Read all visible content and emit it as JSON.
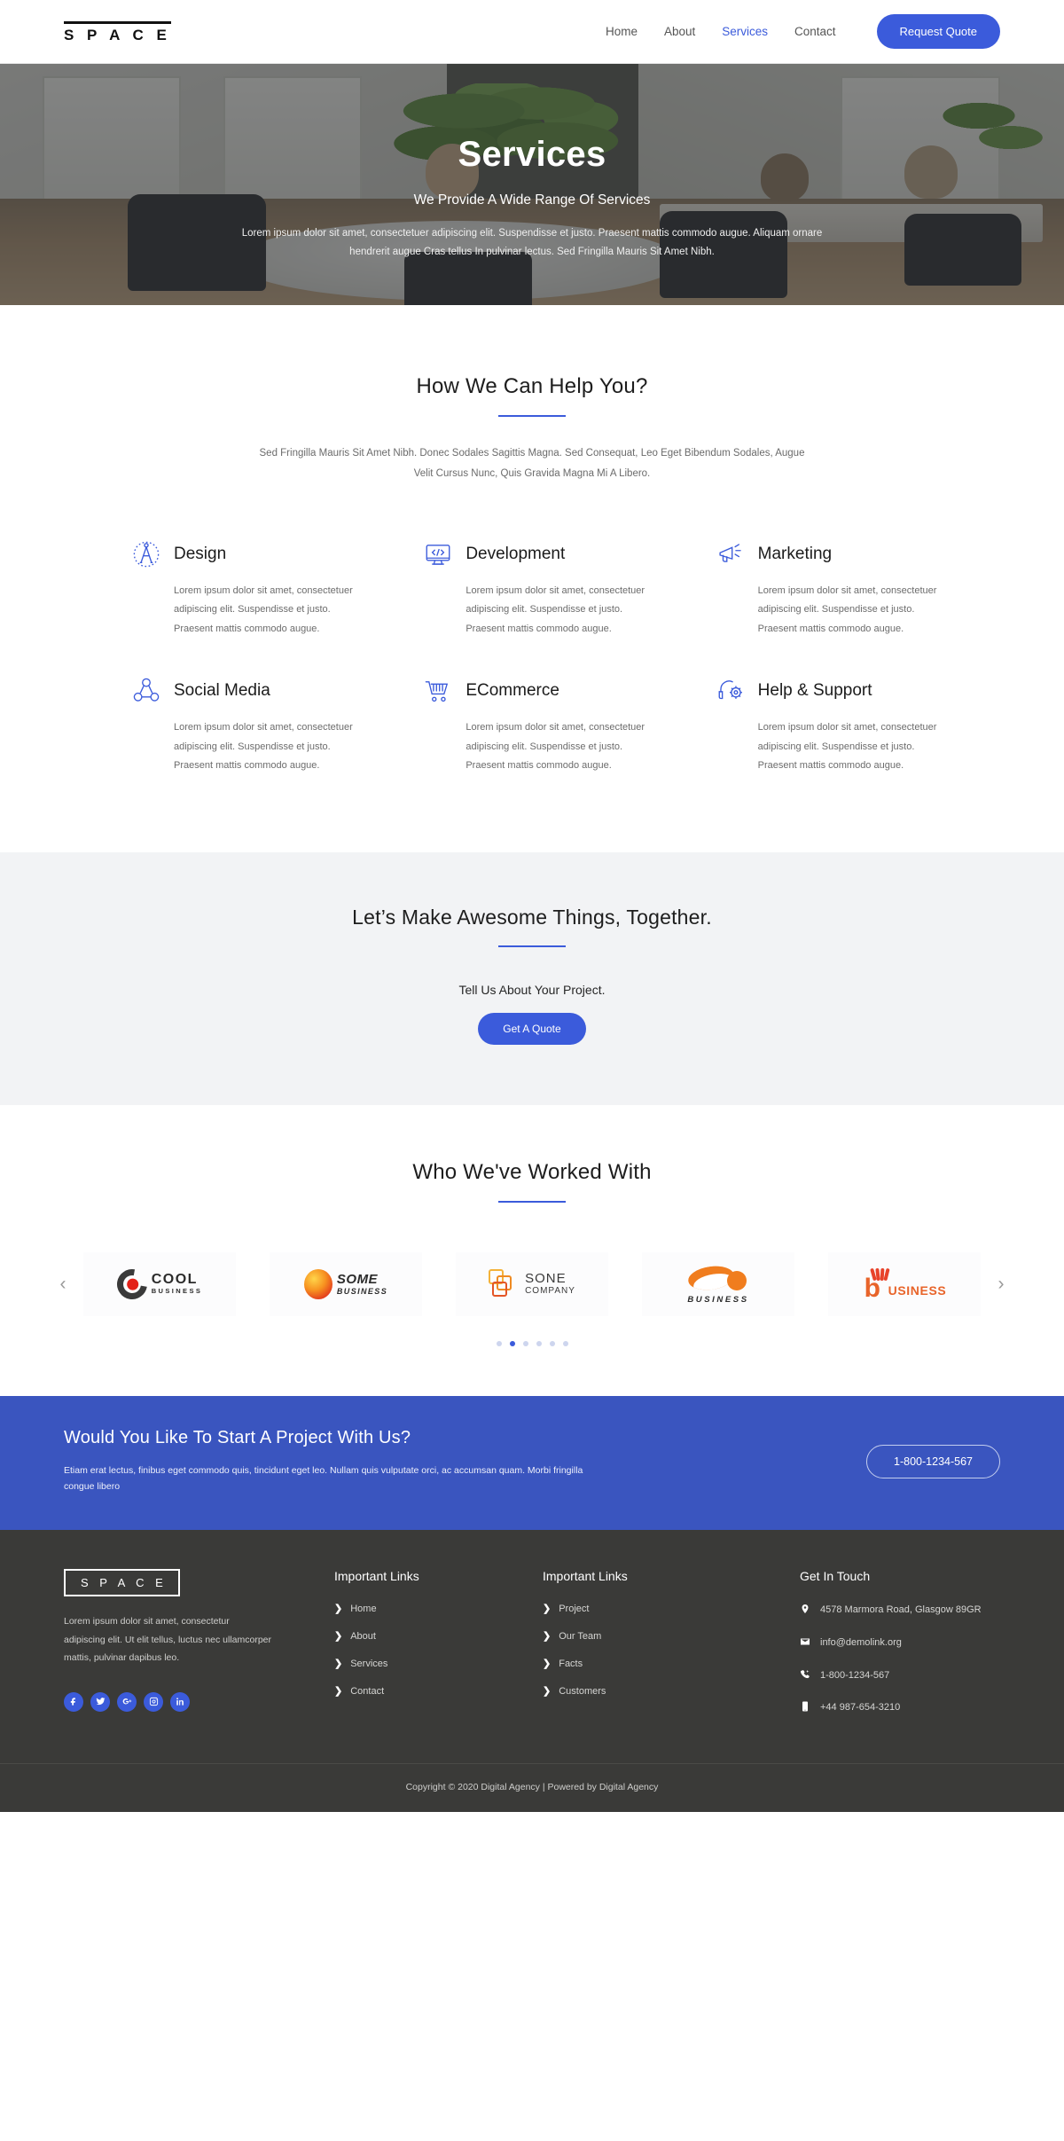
{
  "header": {
    "logo": "S P A C E",
    "nav": [
      {
        "label": "Home",
        "active": false
      },
      {
        "label": "About",
        "active": false
      },
      {
        "label": "Services",
        "active": true
      },
      {
        "label": "Contact",
        "active": false
      }
    ],
    "cta_label": "Request Quote",
    "accent_color": "#3b5bdb"
  },
  "hero": {
    "title": "Services",
    "subtitle": "We Provide A Wide Range Of Services",
    "paragraph": "Lorem ipsum dolor sit amet, consectetuer adipiscing elit. Suspendisse et justo. Praesent mattis commodo augue. Aliquam ornare hendrerit augue Cras tellus In pulvinar lectus. Sed Fringilla Mauris Sit Amet Nibh."
  },
  "services_section": {
    "title": "How We Can Help You?",
    "lead": "Sed Fringilla Mauris Sit Amet Nibh. Donec Sodales Sagittis Magna. Sed Consequat, Leo Eget Bibendum Sodales, Augue Velit Cursus Nunc, Quis Gravida Magna Mi A Libero.",
    "items": [
      {
        "icon": "compass-icon",
        "title": "Design",
        "text": "Lorem ipsum dolor sit amet, consectetuer adipiscing elit. Suspendisse et justo. Praesent mattis commodo augue."
      },
      {
        "icon": "code-monitor-icon",
        "title": "Development",
        "text": "Lorem ipsum dolor sit amet, consectetuer adipiscing elit. Suspendisse et justo. Praesent mattis commodo augue."
      },
      {
        "icon": "megaphone-icon",
        "title": "Marketing",
        "text": "Lorem ipsum dolor sit amet, consectetuer adipiscing elit. Suspendisse et justo. Praesent mattis commodo augue."
      },
      {
        "icon": "share-network-icon",
        "title": "Social Media",
        "text": "Lorem ipsum dolor sit amet, consectetuer adipiscing elit. Suspendisse et justo. Praesent mattis commodo augue."
      },
      {
        "icon": "shopping-cart-icon",
        "title": "ECommerce",
        "text": "Lorem ipsum dolor sit amet, consectetuer adipiscing elit. Suspendisse et justo. Praesent mattis commodo augue."
      },
      {
        "icon": "headset-gear-icon",
        "title": "Help & Support",
        "text": "Lorem ipsum dolor sit amet, consectetuer adipiscing elit. Suspendisse et justo. Praesent mattis commodo augue."
      }
    ]
  },
  "cta": {
    "title": "Let’s Make Awesome Things, Together.",
    "tell": "Tell Us About Your Project.",
    "button": "Get A Quote"
  },
  "clients": {
    "title": "Who We've Worked With",
    "prev_icon": "chevron-left-icon",
    "next_icon": "chevron-right-icon",
    "logos": [
      {
        "name": "COOL",
        "sub": "BUSINESS"
      },
      {
        "name": "SOME",
        "sub": "BUSINESS"
      },
      {
        "name": "SONE",
        "sub": "COMPANY"
      },
      {
        "name": "BUSINESS",
        "sub": ""
      },
      {
        "name": "USINESS",
        "sub": ""
      }
    ],
    "dots": [
      false,
      true,
      false,
      false,
      false,
      false
    ]
  },
  "banner": {
    "heading": "Would You Like To Start A Project With Us?",
    "text": "Etiam erat lectus, finibus eget commodo quis, tincidunt eget leo. Nullam quis vulputate orci, ac accumsan quam. Morbi fringilla congue libero",
    "phone_label": "1-800-1234-567",
    "bg_color": "#3a55bf"
  },
  "footer": {
    "logo": "S P A C E",
    "about": "Lorem ipsum dolor sit amet, consectetur adipiscing elit. Ut elit tellus, luctus nec ullamcorper mattis, pulvinar dapibus leo.",
    "socials": [
      {
        "name": "facebook-icon"
      },
      {
        "name": "twitter-icon"
      },
      {
        "name": "google-plus-icon"
      },
      {
        "name": "instagram-icon"
      },
      {
        "name": "linkedin-icon"
      }
    ],
    "links_col1": {
      "title": "Important Links",
      "items": [
        "Home",
        "About",
        "Services",
        "Contact"
      ]
    },
    "links_col2": {
      "title": "Important Links",
      "items": [
        "Project",
        "Our Team",
        "Facts",
        "Customers"
      ]
    },
    "contact": {
      "title": "Get In Touch",
      "items": [
        {
          "icon": "location-pin-icon",
          "value": "4578 Marmora Road, Glasgow 89GR"
        },
        {
          "icon": "envelope-icon",
          "value": "info@demolink.org"
        },
        {
          "icon": "phone-icon",
          "value": "1-800-1234-567"
        },
        {
          "icon": "mobile-icon",
          "value": "+44 987-654-3210"
        }
      ]
    },
    "copyright": "Copyright © 2020 Digital Agency | Powered by Digital Agency"
  }
}
